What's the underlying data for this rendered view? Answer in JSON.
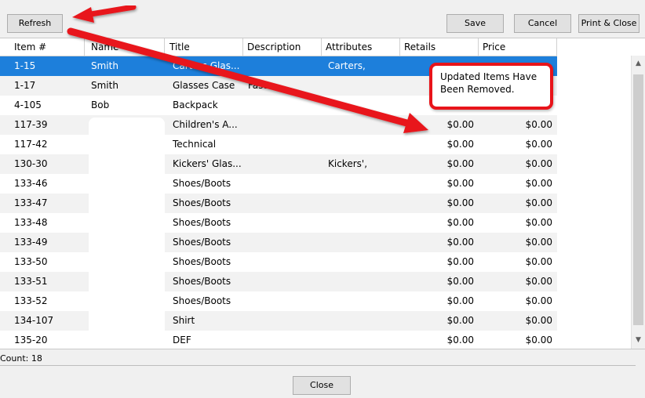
{
  "toolbar": {
    "refresh_label": "Refresh",
    "save_label": "Save",
    "cancel_label": "Cancel",
    "print_close_label": "Print & Close"
  },
  "grid": {
    "columns": [
      "Item #",
      "Name",
      "Title",
      "Description",
      "Attributes",
      "Retails",
      "Price"
    ],
    "selected_row_index": 0,
    "rows": [
      {
        "item": "1-15",
        "name": "Smith",
        "title": "Carters Glas...",
        "description": "",
        "attributes": "Carters,",
        "retail": "",
        "price": ""
      },
      {
        "item": "1-17",
        "name": "Smith",
        "title": "Glasses Case",
        "description": "Fast",
        "attributes": "",
        "retail": "",
        "price": ""
      },
      {
        "item": "4-105",
        "name": "Bob",
        "title": "Backpack",
        "description": "",
        "attributes": "",
        "retail": "",
        "price": ""
      },
      {
        "item": "117-39",
        "name": "",
        "title": "Children's A...",
        "description": "",
        "attributes": "",
        "retail": "$0.00",
        "price": "$0.00"
      },
      {
        "item": "117-42",
        "name": "",
        "title": "Technical",
        "description": "",
        "attributes": "",
        "retail": "$0.00",
        "price": "$0.00"
      },
      {
        "item": "130-30",
        "name": "",
        "title": "Kickers' Glas...",
        "description": "",
        "attributes": "Kickers',",
        "retail": "$0.00",
        "price": "$0.00"
      },
      {
        "item": "133-46",
        "name": "",
        "title": "Shoes/Boots",
        "description": "",
        "attributes": "",
        "retail": "$0.00",
        "price": "$0.00"
      },
      {
        "item": "133-47",
        "name": "",
        "title": "Shoes/Boots",
        "description": "",
        "attributes": "",
        "retail": "$0.00",
        "price": "$0.00"
      },
      {
        "item": "133-48",
        "name": "",
        "title": "Shoes/Boots",
        "description": "",
        "attributes": "",
        "retail": "$0.00",
        "price": "$0.00"
      },
      {
        "item": "133-49",
        "name": "",
        "title": "Shoes/Boots",
        "description": "",
        "attributes": "",
        "retail": "$0.00",
        "price": "$0.00"
      },
      {
        "item": "133-50",
        "name": "",
        "title": "Shoes/Boots",
        "description": "",
        "attributes": "",
        "retail": "$0.00",
        "price": "$0.00"
      },
      {
        "item": "133-51",
        "name": "",
        "title": "Shoes/Boots",
        "description": "",
        "attributes": "",
        "retail": "$0.00",
        "price": "$0.00"
      },
      {
        "item": "133-52",
        "name": "",
        "title": "Shoes/Boots",
        "description": "",
        "attributes": "",
        "retail": "$0.00",
        "price": "$0.00"
      },
      {
        "item": "134-107",
        "name": "",
        "title": "Shirt",
        "description": "",
        "attributes": "",
        "retail": "$0.00",
        "price": "$0.00"
      },
      {
        "item": "135-20",
        "name": "",
        "title": "DEF",
        "description": "",
        "attributes": "",
        "retail": "$0.00",
        "price": "$0.00"
      }
    ]
  },
  "callout": {
    "line1": "Updated Items Have",
    "line2": "Been Removed."
  },
  "footer": {
    "count_label": "Count: 18",
    "close_label": "Close"
  },
  "colors": {
    "selection": "#1d7fdb",
    "annotation_red": "#e8141a"
  },
  "icons": {
    "scroll_up": "chevron-up-icon",
    "scroll_down": "chevron-down-icon"
  }
}
